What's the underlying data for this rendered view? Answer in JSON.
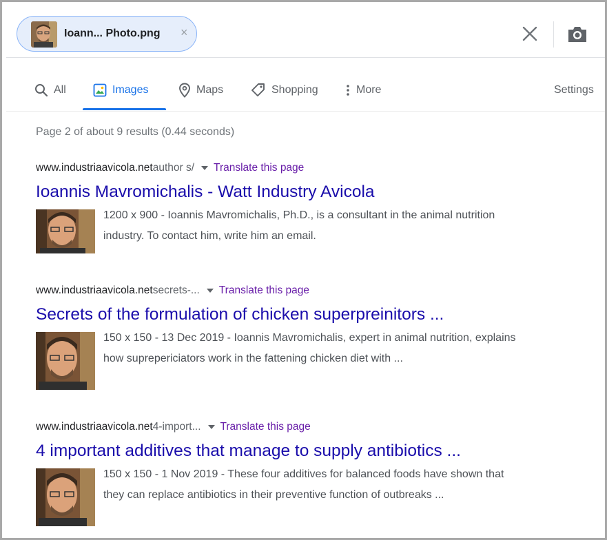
{
  "search": {
    "chip_label": "Ioann... Photo.png",
    "chip_close": "×"
  },
  "tabs": [
    {
      "label": "All",
      "icon": "search-icon"
    },
    {
      "label": "Images",
      "icon": "image-icon",
      "active": true
    },
    {
      "label": "Maps",
      "icon": "map-pin-icon"
    },
    {
      "label": "Shopping",
      "icon": "tag-icon"
    },
    {
      "label": "More",
      "icon": "more-vert-icon"
    }
  ],
  "settings_label": "Settings",
  "stats": "Page 2 of about 9 results (0.44 seconds)",
  "results": [
    {
      "site": "www.industriaavicola.net",
      "crumb": " author s/",
      "translate": "Translate this page",
      "title": "Ioannis Mavromichalis - Watt Industry Avicola",
      "snippet_line1": "1200 x 900 - Ioannis Mavromichalis, Ph.D., is a consultant in the animal nutrition",
      "snippet_line2": "industry. To contact him, write him an email."
    },
    {
      "site": "www.industriaavicola.net",
      "crumb": " secrets-...",
      "translate": "Translate this page",
      "title": "Secrets of the formulation of chicken superpreinitors ...",
      "snippet_line1": "150 x 150 - 13 Dec 2019 - Ioannis Mavromichalis, expert in animal nutrition, explains",
      "snippet_line2": "how suprepericiators work in the fattening chicken diet with ..."
    },
    {
      "site": "www.industriaavicola.net",
      "crumb": " 4-import...",
      "translate": "Translate this page",
      "title": "4 important additives that manage to supply antibiotics ...",
      "snippet_line1": "150 x 150 - 1 Nov 2019 - These four additives for balanced foods have shown that",
      "snippet_line2": "they can replace antibiotics in their preventive function of outbreaks ..."
    }
  ],
  "colors": {
    "link": "#1a0dab",
    "translate": "#681da8",
    "accent": "#1a73e8",
    "chip_bg": "#e6eefb"
  }
}
